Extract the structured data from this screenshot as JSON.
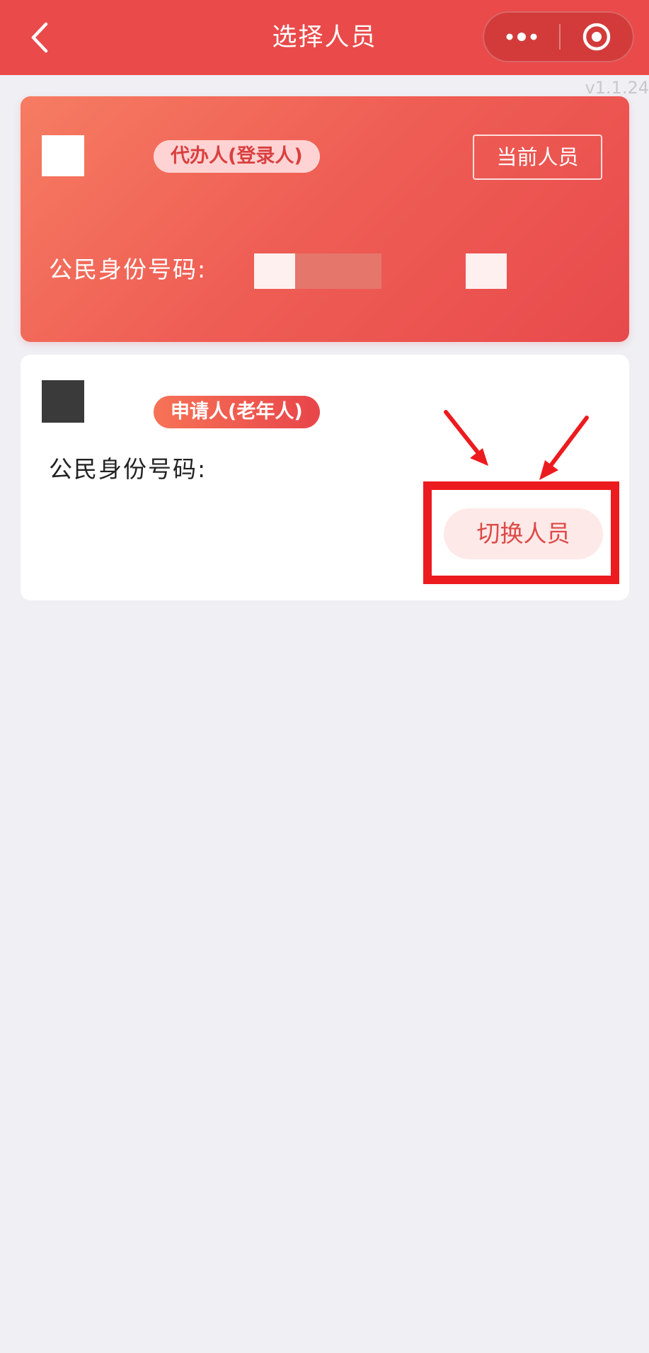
{
  "navbar": {
    "title": "选择人员",
    "background": "#ea4a4a",
    "back_icon": "chevron-left-icon",
    "more_icon": "more-dots-icon",
    "close_icon": "target-circle-icon"
  },
  "version": "v1.1.24",
  "agent_card": {
    "role_tag": "代办人(登录人)",
    "current_button": "当前人员",
    "id_label": "公民身份号码:"
  },
  "applicant_card": {
    "role_tag": "申请人(老年人)",
    "id_label": "公民身份号码:",
    "switch_button": "切换人员"
  },
  "annotation": {
    "highlight_color": "#ec1b1f",
    "arrow_icon": "red-arrow-icon"
  }
}
